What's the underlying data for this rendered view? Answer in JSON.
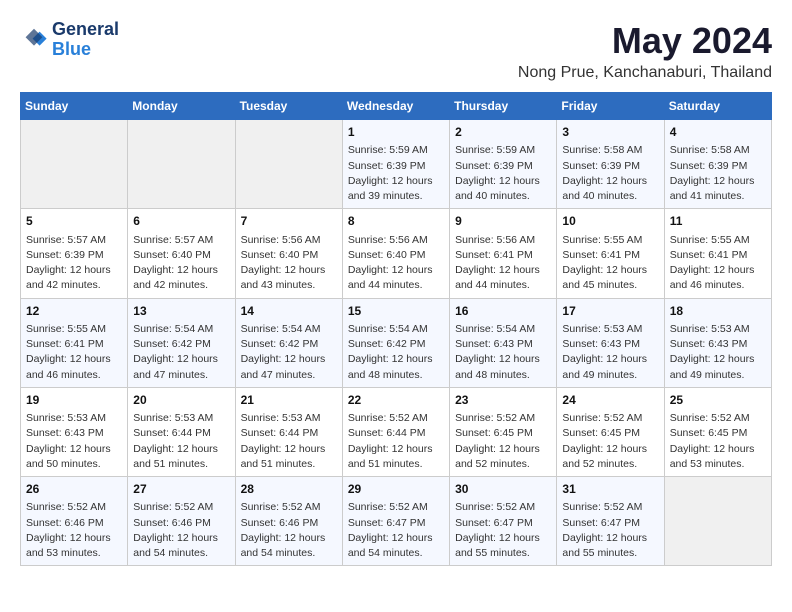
{
  "header": {
    "logo_line1": "General",
    "logo_line2": "Blue",
    "month_title": "May 2024",
    "location": "Nong Prue, Kanchanaburi, Thailand"
  },
  "weekdays": [
    "Sunday",
    "Monday",
    "Tuesday",
    "Wednesday",
    "Thursday",
    "Friday",
    "Saturday"
  ],
  "weeks": [
    [
      {
        "day": "",
        "info": ""
      },
      {
        "day": "",
        "info": ""
      },
      {
        "day": "",
        "info": ""
      },
      {
        "day": "1",
        "info": "Sunrise: 5:59 AM\nSunset: 6:39 PM\nDaylight: 12 hours\nand 39 minutes."
      },
      {
        "day": "2",
        "info": "Sunrise: 5:59 AM\nSunset: 6:39 PM\nDaylight: 12 hours\nand 40 minutes."
      },
      {
        "day": "3",
        "info": "Sunrise: 5:58 AM\nSunset: 6:39 PM\nDaylight: 12 hours\nand 40 minutes."
      },
      {
        "day": "4",
        "info": "Sunrise: 5:58 AM\nSunset: 6:39 PM\nDaylight: 12 hours\nand 41 minutes."
      }
    ],
    [
      {
        "day": "5",
        "info": "Sunrise: 5:57 AM\nSunset: 6:39 PM\nDaylight: 12 hours\nand 42 minutes."
      },
      {
        "day": "6",
        "info": "Sunrise: 5:57 AM\nSunset: 6:40 PM\nDaylight: 12 hours\nand 42 minutes."
      },
      {
        "day": "7",
        "info": "Sunrise: 5:56 AM\nSunset: 6:40 PM\nDaylight: 12 hours\nand 43 minutes."
      },
      {
        "day": "8",
        "info": "Sunrise: 5:56 AM\nSunset: 6:40 PM\nDaylight: 12 hours\nand 44 minutes."
      },
      {
        "day": "9",
        "info": "Sunrise: 5:56 AM\nSunset: 6:41 PM\nDaylight: 12 hours\nand 44 minutes."
      },
      {
        "day": "10",
        "info": "Sunrise: 5:55 AM\nSunset: 6:41 PM\nDaylight: 12 hours\nand 45 minutes."
      },
      {
        "day": "11",
        "info": "Sunrise: 5:55 AM\nSunset: 6:41 PM\nDaylight: 12 hours\nand 46 minutes."
      }
    ],
    [
      {
        "day": "12",
        "info": "Sunrise: 5:55 AM\nSunset: 6:41 PM\nDaylight: 12 hours\nand 46 minutes."
      },
      {
        "day": "13",
        "info": "Sunrise: 5:54 AM\nSunset: 6:42 PM\nDaylight: 12 hours\nand 47 minutes."
      },
      {
        "day": "14",
        "info": "Sunrise: 5:54 AM\nSunset: 6:42 PM\nDaylight: 12 hours\nand 47 minutes."
      },
      {
        "day": "15",
        "info": "Sunrise: 5:54 AM\nSunset: 6:42 PM\nDaylight: 12 hours\nand 48 minutes."
      },
      {
        "day": "16",
        "info": "Sunrise: 5:54 AM\nSunset: 6:43 PM\nDaylight: 12 hours\nand 48 minutes."
      },
      {
        "day": "17",
        "info": "Sunrise: 5:53 AM\nSunset: 6:43 PM\nDaylight: 12 hours\nand 49 minutes."
      },
      {
        "day": "18",
        "info": "Sunrise: 5:53 AM\nSunset: 6:43 PM\nDaylight: 12 hours\nand 49 minutes."
      }
    ],
    [
      {
        "day": "19",
        "info": "Sunrise: 5:53 AM\nSunset: 6:43 PM\nDaylight: 12 hours\nand 50 minutes."
      },
      {
        "day": "20",
        "info": "Sunrise: 5:53 AM\nSunset: 6:44 PM\nDaylight: 12 hours\nand 51 minutes."
      },
      {
        "day": "21",
        "info": "Sunrise: 5:53 AM\nSunset: 6:44 PM\nDaylight: 12 hours\nand 51 minutes."
      },
      {
        "day": "22",
        "info": "Sunrise: 5:52 AM\nSunset: 6:44 PM\nDaylight: 12 hours\nand 51 minutes."
      },
      {
        "day": "23",
        "info": "Sunrise: 5:52 AM\nSunset: 6:45 PM\nDaylight: 12 hours\nand 52 minutes."
      },
      {
        "day": "24",
        "info": "Sunrise: 5:52 AM\nSunset: 6:45 PM\nDaylight: 12 hours\nand 52 minutes."
      },
      {
        "day": "25",
        "info": "Sunrise: 5:52 AM\nSunset: 6:45 PM\nDaylight: 12 hours\nand 53 minutes."
      }
    ],
    [
      {
        "day": "26",
        "info": "Sunrise: 5:52 AM\nSunset: 6:46 PM\nDaylight: 12 hours\nand 53 minutes."
      },
      {
        "day": "27",
        "info": "Sunrise: 5:52 AM\nSunset: 6:46 PM\nDaylight: 12 hours\nand 54 minutes."
      },
      {
        "day": "28",
        "info": "Sunrise: 5:52 AM\nSunset: 6:46 PM\nDaylight: 12 hours\nand 54 minutes."
      },
      {
        "day": "29",
        "info": "Sunrise: 5:52 AM\nSunset: 6:47 PM\nDaylight: 12 hours\nand 54 minutes."
      },
      {
        "day": "30",
        "info": "Sunrise: 5:52 AM\nSunset: 6:47 PM\nDaylight: 12 hours\nand 55 minutes."
      },
      {
        "day": "31",
        "info": "Sunrise: 5:52 AM\nSunset: 6:47 PM\nDaylight: 12 hours\nand 55 minutes."
      },
      {
        "day": "",
        "info": ""
      }
    ]
  ]
}
